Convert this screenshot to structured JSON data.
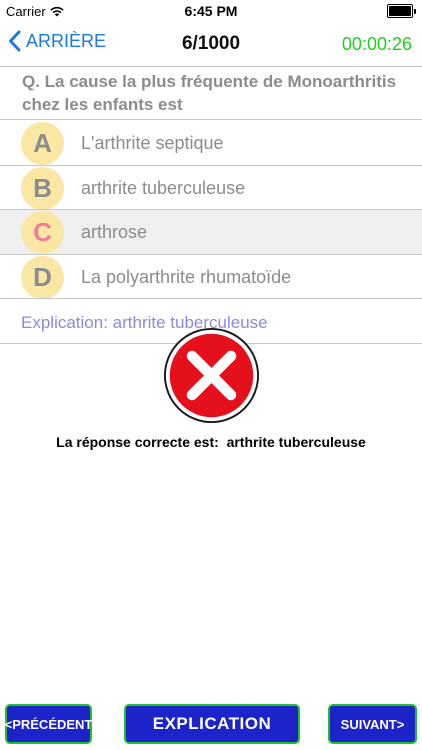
{
  "status_bar": {
    "carrier": "Carrier",
    "time": "6:45 PM",
    "wifi_icon": "wifi-icon",
    "battery_icon": "battery-icon"
  },
  "nav": {
    "back_label": "ARRIÈRE",
    "title": "6/1000",
    "timer": "00:00:26",
    "timer_color": "#1dd11d",
    "accent": "#1a7ae0"
  },
  "question": {
    "text": "Q. La cause la plus fréquente de Monoarthritis chez les enfants est"
  },
  "answers": [
    {
      "letter": "A",
      "text": "L'arthrite septique"
    },
    {
      "letter": "B",
      "text": "arthrite tuberculeuse"
    },
    {
      "letter": "C",
      "text": "arthrose",
      "selected": true
    },
    {
      "letter": "D",
      "text": "La polyarthrite rhumatoïde"
    }
  ],
  "explication": "Explication: arthrite tuberculeuse",
  "result": {
    "icon": "wrong-x-icon",
    "correct_label": "La réponse correcte est:",
    "correct_value": "arthrite tuberculeuse"
  },
  "buttons": {
    "prev": "<PRÉCÉDENT",
    "explication": "EXPLICATION",
    "next": "SUIVANT>"
  }
}
